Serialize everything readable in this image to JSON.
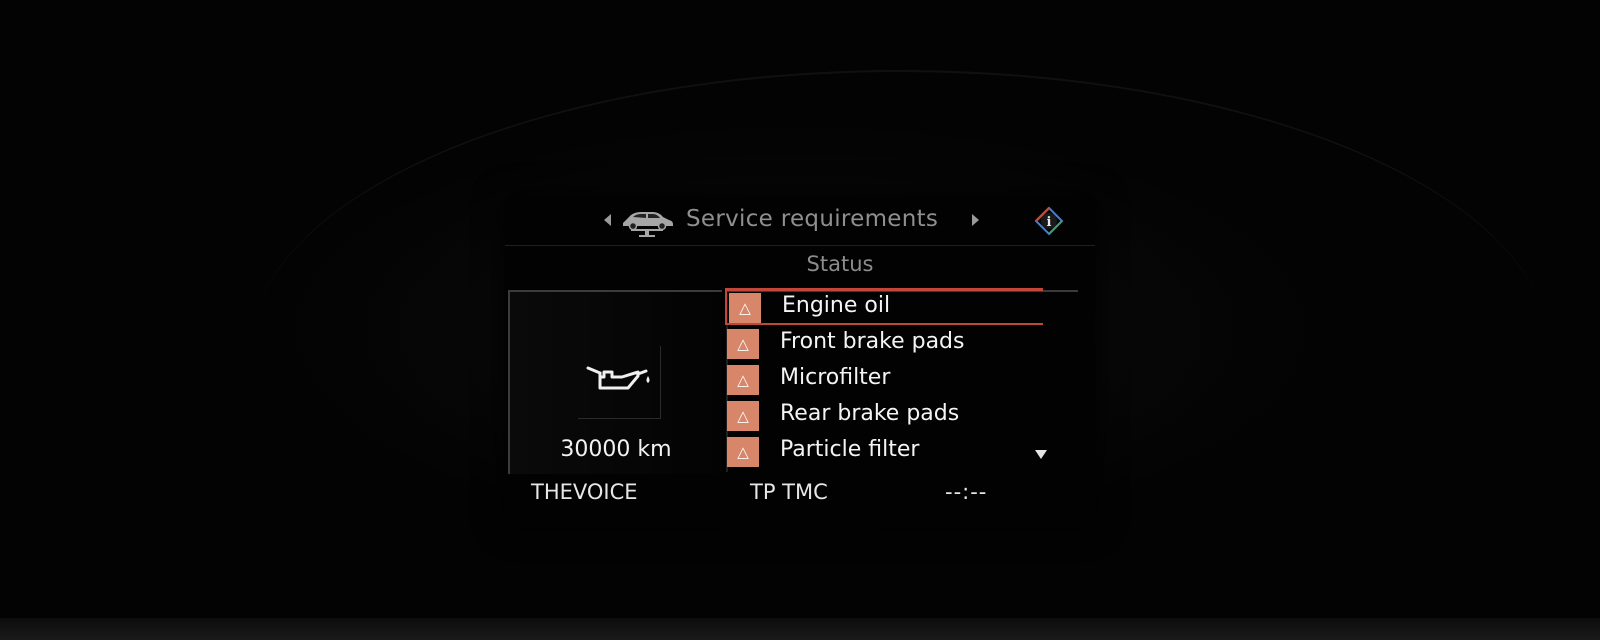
{
  "header": {
    "title": "Service requirements",
    "nav_left_icon": "chevron-left-icon",
    "nav_right_icon": "chevron-right-icon",
    "car_icon": "car-on-lift-icon",
    "info_icon": "info-icon"
  },
  "subtitle": "Status",
  "detail": {
    "icon": "oil-can-icon",
    "distance": "30000 km"
  },
  "service_items": [
    {
      "label": "Engine oil",
      "selected": true,
      "icon": "warning-triangle-icon"
    },
    {
      "label": "Front brake pads",
      "selected": false,
      "icon": "warning-triangle-icon"
    },
    {
      "label": "Microfilter",
      "selected": false,
      "icon": "warning-triangle-icon"
    },
    {
      "label": "Rear brake pads",
      "selected": false,
      "icon": "warning-triangle-icon"
    },
    {
      "label": "Particle filter",
      "selected": false,
      "icon": "warning-triangle-icon"
    }
  ],
  "warning_glyph": "△",
  "status_bar": {
    "source": "THEVOICE",
    "traffic": "TP TMC",
    "clock": "--:--"
  },
  "colors": {
    "warning_bg": "#d8866a",
    "selection": "#c2463a",
    "text": "#f4f4f4",
    "muted_text": "#8f8f8f"
  }
}
